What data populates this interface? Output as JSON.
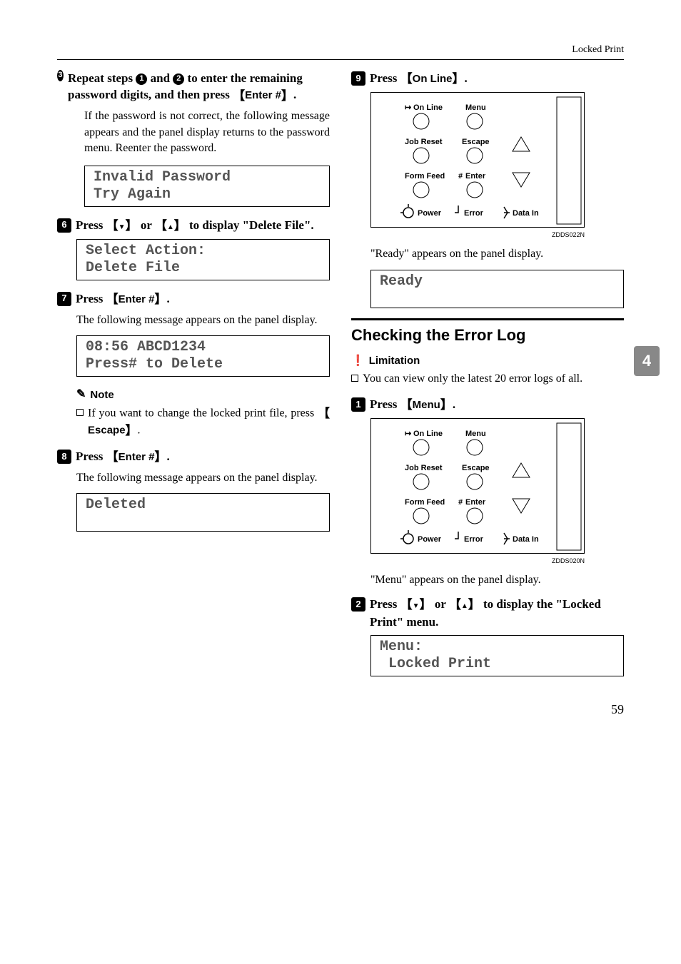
{
  "header": {
    "title": "Locked Print"
  },
  "side_tab": "4",
  "page_number": "59",
  "left": {
    "step5": {
      "text_before": "Repeat steps ",
      "text_mid1": " and ",
      "text_mid2": " to enter the remaining password digits, and then press ",
      "key": "Enter #",
      "body": "If the password is not correct, the following message appears and the panel display returns to the password menu. Reenter the password.",
      "lcd": "Invalid Password\nTry Again"
    },
    "step6": {
      "text_before": "Press ",
      "text_mid": " or ",
      "text_after": " to display \"Delete File\".",
      "lcd": "Select Action:\nDelete File"
    },
    "step7": {
      "text": "Press ",
      "key": "Enter #",
      "body": "The following message appears on the panel display.",
      "lcd": "08:56 ABCD1234\nPress# to Delete"
    },
    "note": {
      "heading": "Note",
      "body_prefix": "If you want to change the locked print file, press ",
      "key": "Escape"
    },
    "step8": {
      "text": "Press ",
      "key": "Enter #",
      "body": "The following message appears on the panel display.",
      "lcd": "Deleted"
    }
  },
  "right": {
    "step9": {
      "text": "Press ",
      "key": "On Line",
      "svg_code": "ZDDS022N",
      "panel": {
        "btn1": "On Line",
        "btn2": "Menu",
        "btn3": "Job Reset",
        "btn4": "Escape",
        "btn5": "Form Feed",
        "btn6_prefix": "#",
        "btn6": "Enter",
        "lbl1": "Power",
        "lbl2": "Error",
        "lbl3": "Data In"
      },
      "body": "\"Ready\" appears on the panel display.",
      "lcd": "Ready"
    },
    "section_title": "Checking the Error Log",
    "limitation": {
      "heading": "Limitation",
      "body": "You can view only the latest 20 error logs of all."
    },
    "step1": {
      "text": "Press ",
      "key": "Menu",
      "svg_code": "ZDDS020N",
      "panel": {
        "btn1": "On Line",
        "btn2": "Menu",
        "btn3": "Job Reset",
        "btn4": "Escape",
        "btn5": "Form Feed",
        "btn6_prefix": "#",
        "btn6": "Enter",
        "lbl1": "Power",
        "lbl2": "Error",
        "lbl3": "Data In"
      },
      "body": "\"Menu\" appears on the panel display."
    },
    "step2": {
      "text_before": "Press ",
      "text_mid": " or ",
      "text_after": " to display the \"Locked Print\" menu.",
      "lcd": "Menu:\n Locked Print"
    }
  }
}
